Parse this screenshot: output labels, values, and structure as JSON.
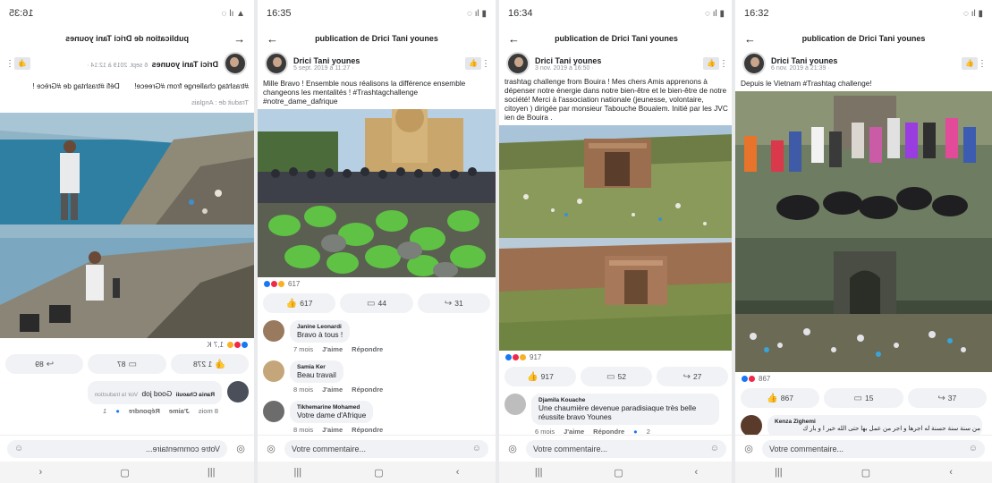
{
  "panel1": {
    "status_time": "16:35",
    "title": "publication de Drici Tani younes",
    "author": "Drici Tani younes",
    "date": "6 sept. 2019 à 12:14 · ",
    "text_line1": "#trashtag challenge from #Greece!",
    "text_line2": "Défi #trashtag de #Grèce !",
    "translate": "Traduit de : Anglais",
    "reaction_count": "1,7 K",
    "like_count": "1 278",
    "comment_count": "87",
    "share_count": "89",
    "comment_name": "Rania Chaouii",
    "comment_text": "Good job",
    "comment_sub": "Voir la traduction",
    "comment_time": "8 mois",
    "comment_like": "J'aime",
    "comment_reply": "Répondre",
    "comment_likes": "1",
    "input_placeholder": "Votre commentaire..."
  },
  "panel2": {
    "status_time": "16:35",
    "title": "publication de Drici Tani younes",
    "author": "Drici Tani younes",
    "date": "5 sept. 2019 à 11:27 · ",
    "text": "Mille Bravo ! Ensemble nous réalisons la différence ensemble changeons les mentalités ! #Trashtagchallenge #notre_dame_dafrique",
    "reaction_count": "617",
    "like_count": "617",
    "comment_count": "44",
    "share_count": "31",
    "comments": [
      {
        "name": "Janine Leonardi",
        "text": "Bravo à tous !",
        "time": "7 mois",
        "like": "J'aime",
        "reply": "Répondre"
      },
      {
        "name": "Samia Ker",
        "text": "Beau travail",
        "time": "8 mois",
        "like": "J'aime",
        "reply": "Répondre"
      },
      {
        "name": "Tikhemarine Mohamed",
        "text": "Votre dame d'Afrique",
        "time": "8 mois",
        "like": "J'aime",
        "reply": "Répondre"
      }
    ],
    "input_placeholder": "Votre commentaire..."
  },
  "panel3": {
    "status_time": "16:34",
    "title": "publication de Drici Tani younes",
    "author": "Drici Tani younes",
    "date": "3 nov. 2019 à 16:50 · ",
    "text": "trashtag challenge from Bouira ! Mes chers Amis apprenons à dépenser notre énergie dans notre bien-être et le bien-être de notre société! Merci à l'association nationale (jeunesse, volontaire, citoyen ) dirigée par monsieur Tabouche Boualem. Initié par les JVC ien de Bouira .",
    "reaction_count": "917",
    "like_count": "917",
    "comment_count": "52",
    "share_count": "27",
    "comment_name": "Djamila Kouache",
    "comment_text": "Une chaumière devenue paradisiaque très belle réussite bravo Younes",
    "comment_time": "6 mois",
    "comment_like": "J'aime",
    "comment_reply": "Répondre",
    "comment_likes": "2",
    "input_placeholder": "Votre commentaire..."
  },
  "panel4": {
    "status_time": "16:32",
    "title": "publication de Drici Tani younes",
    "author": "Drici Tani younes",
    "date": "6 nov. 2019 à 21:39 · ",
    "text": "Depuis le Vietnam #Trashtag challenge!",
    "reaction_count": "867",
    "like_count": "867",
    "comment_count": "15",
    "share_count": "37",
    "comment_name": "Kenza Zighemi",
    "comment_text": "من سنة سنة حسنة له اجرها و اجر من عمل بها حتى الله خير ا و بار ك",
    "input_placeholder": "Votre commentaire..."
  },
  "icons": {
    "back": "arrow-left-icon",
    "like": "thumb-up-icon",
    "comment": "comment-bubble-icon",
    "share": "share-arrow-icon",
    "camera": "camera-icon",
    "emoji": "smile-icon",
    "menu": "recents-icon",
    "home": "home-icon",
    "navback": "back-chevron-icon"
  },
  "colors": {
    "facebook_blue": "#1877f2",
    "love_red": "#f02849",
    "wow_yellow": "#f7b125"
  }
}
